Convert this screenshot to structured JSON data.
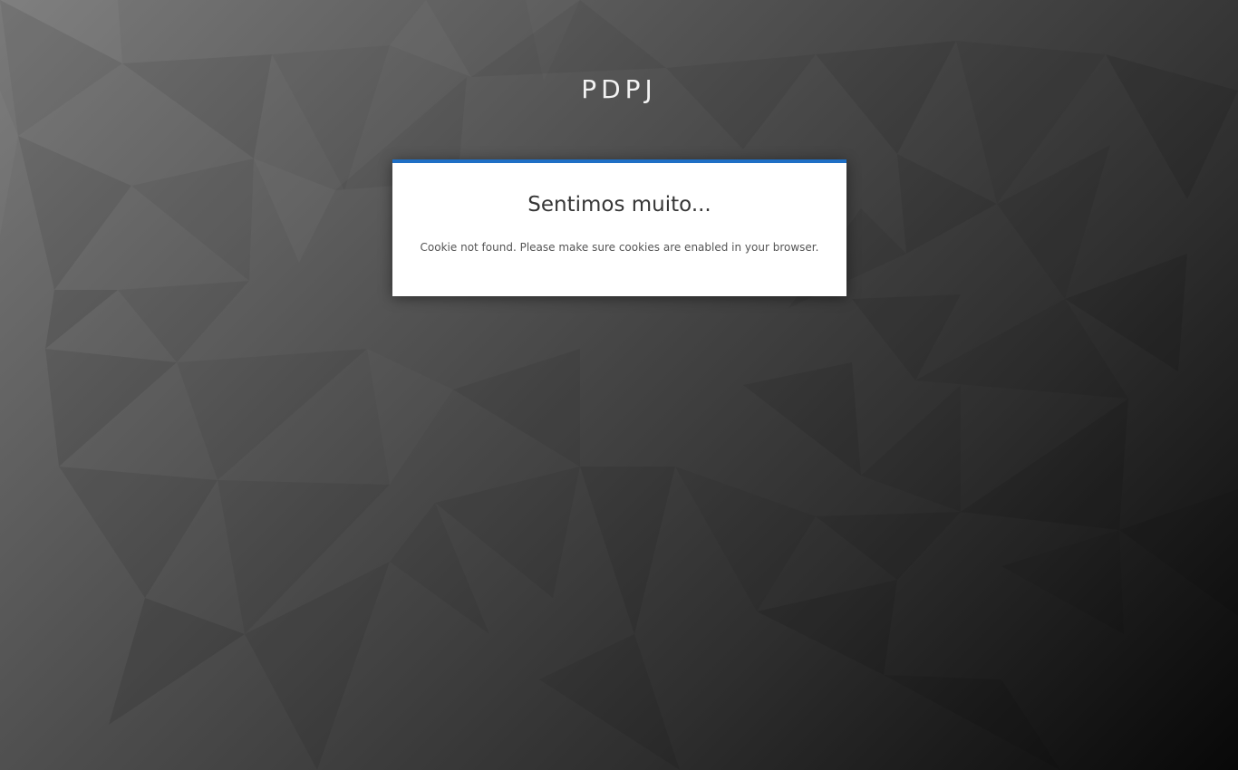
{
  "brand": {
    "title": "PDPJ"
  },
  "error_card": {
    "title": "Sentimos muito...",
    "message": "Cookie not found. Please make sure cookies are enabled in your browser.",
    "accent_color": "#1f6fc5"
  },
  "background": {
    "style": "low-poly gradient",
    "color_light": "#7a7a7a",
    "color_dark": "#080808"
  }
}
